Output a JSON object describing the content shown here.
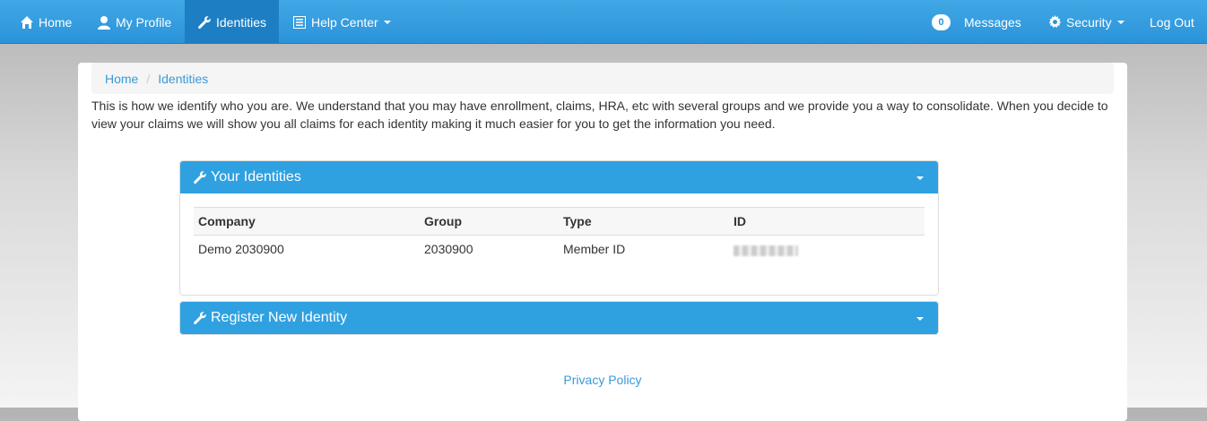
{
  "nav": {
    "home": "Home",
    "my_profile": "My Profile",
    "identities": "Identities",
    "help_center": "Help Center",
    "messages_count": "0",
    "messages": "Messages",
    "security": "Security",
    "log_out": "Log Out"
  },
  "breadcrumb": {
    "home": "Home",
    "current": "Identities"
  },
  "intro_text": "This is how we identify who you are. We understand that you may have enrollment, claims, HRA, etc with several groups and we provide you a way to consolidate. When you decide to view your claims we will show you all claims for each identity making it much easier for you to get the information you need.",
  "your_identities": {
    "title": "Your Identities",
    "columns": [
      "Company",
      "Group",
      "Type",
      "ID"
    ],
    "rows": [
      {
        "company": "Demo 2030900",
        "group": "2030900",
        "type": "Member ID"
      }
    ]
  },
  "register": {
    "title": "Register New Identity"
  },
  "footer": {
    "privacy": "Privacy Policy"
  },
  "icons": {
    "home": "home-icon",
    "profile": "user-icon",
    "identities": "wrench-icon",
    "help": "list-icon",
    "security": "gear-icon"
  },
  "colors": {
    "navbar": "#2b93d9",
    "active_nav": "#1e7ec3",
    "panel_heading": "#2fa1e1",
    "link": "#3a9ad9"
  }
}
